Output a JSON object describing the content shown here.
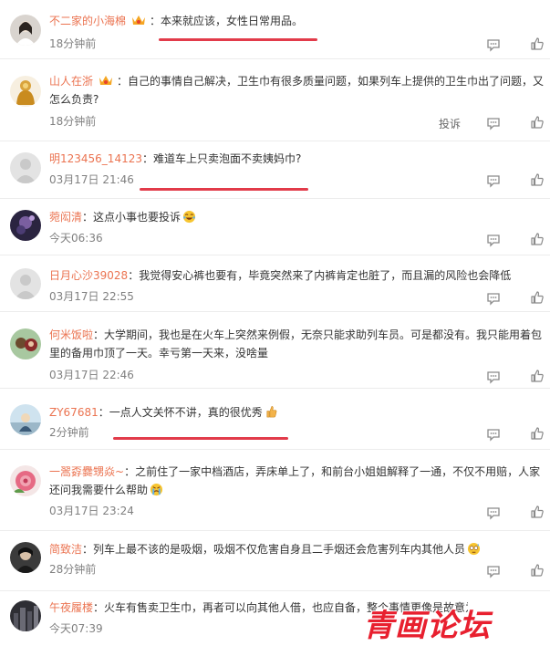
{
  "comments": [
    {
      "user": "不二家的小海棉",
      "crown": true,
      "text": "本来就应该，女性日常用品。",
      "time": "18分钟前"
    },
    {
      "user": "山人在浙",
      "crown": true,
      "text": "自己的事情自己解决，卫生巾有很多质量问题，如果列车上提供的卫生巾出了问题，又怎么负责?",
      "time": "18分钟前",
      "report": "投诉"
    },
    {
      "user": "明123456_14123",
      "crown": false,
      "text": "难道车上只卖泡面不卖姨妈巾?",
      "time": "03月17日 21:46"
    },
    {
      "user": "菀闳清",
      "crown": false,
      "text": "这点小事也要投诉",
      "emoji": "laugh-cry-emoji",
      "time": "今天06:36"
    },
    {
      "user": "日月心沙39028",
      "crown": false,
      "text": "我觉得安心裤也要有，毕竟突然来了内裤肯定也脏了，而且漏的风险也会降低",
      "time": "03月17日 22:55"
    },
    {
      "user": "何米饭啦",
      "crown": false,
      "text": "大学期间，我也是在火车上突然来例假，无奈只能求助列车员。可是都没有。我只能用着包里的备用巾顶了一天。幸亏第一天来，没啥量",
      "time": "03月17日 22:46"
    },
    {
      "user": "ZY67681",
      "crown": false,
      "text": "一点人文关怀不讲，真的很优秀",
      "emoji": "thumbs-up-emoji",
      "time": "2分钟前"
    },
    {
      "user": "一翯孬爨甥焱~",
      "crown": false,
      "text": "之前住了一家中档酒店，弄床单上了，和前台小姐姐解释了一通，不仅不用赔，人家还问我需要什么帮助",
      "emoji": "sob-emoji",
      "time": "03月17日 23:24"
    },
    {
      "user": "简致洁",
      "crown": false,
      "text": "列车上最不该的是吸烟，吸烟不仅危害自身且二手烟还会危害列车内其他人员",
      "emoji": "sweat-emoji",
      "time": "28分钟前"
    },
    {
      "user": "午夜履楼",
      "crown": false,
      "text": "火车有售卖卫生巾，再者可以向其他人借，也应自备，整个事情更像是故意为之而炒作",
      "time": "今天07:39"
    }
  ],
  "icons": {
    "reply": "comment-icon",
    "like": "thumbs-up-icon",
    "crown": "crown-badge-icon"
  },
  "watermark": "青画论坛",
  "colors": {
    "username": "#eb7350",
    "highlight": "#e23b4a",
    "meta": "#808080"
  }
}
